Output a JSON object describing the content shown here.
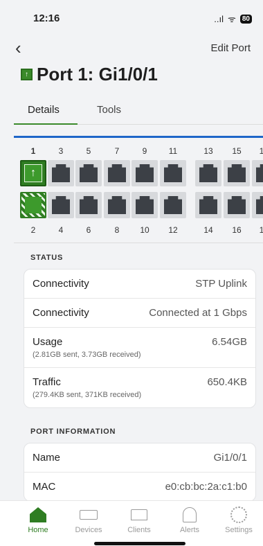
{
  "status_bar": {
    "time": "12:16",
    "signal": "..ıl",
    "wifi": "ᯤ",
    "battery": "80"
  },
  "navbar": {
    "back": "‹",
    "action": "Edit Port"
  },
  "title": {
    "icon_glyph": "↑",
    "text": "Port 1: Gi1/0/1"
  },
  "tabs": [
    {
      "label": "Details",
      "active": true
    },
    {
      "label": "Tools",
      "active": false
    }
  ],
  "ports": {
    "top_numbers": [
      "1",
      "3",
      "5",
      "7",
      "9",
      "11",
      "13",
      "15",
      "1"
    ],
    "bottom_numbers": [
      "2",
      "4",
      "6",
      "8",
      "10",
      "12",
      "14",
      "16",
      "1"
    ],
    "uplink_glyph": "↑"
  },
  "status": {
    "label": "STATUS",
    "rows": [
      {
        "label": "Connectivity",
        "value": "STP Uplink",
        "sub": ""
      },
      {
        "label": "Connectivity",
        "value": "Connected at 1 Gbps",
        "sub": ""
      },
      {
        "label": "Usage",
        "value": "6.54GB",
        "sub": "(2.81GB sent, 3.73GB received)"
      },
      {
        "label": "Traffic",
        "value": "650.4KB",
        "sub": "(279.4KB sent, 371KB received)"
      }
    ]
  },
  "port_info": {
    "label": "PORT INFORMATION",
    "rows": [
      {
        "label": "Name",
        "value": "Gi1/0/1"
      },
      {
        "label": "MAC",
        "value": "e0:cb:bc:2a:c1:b0"
      }
    ]
  },
  "bottom_nav": [
    {
      "label": "Home",
      "icon": "home-icon",
      "active": true
    },
    {
      "label": "Devices",
      "icon": "devices-icon",
      "active": false
    },
    {
      "label": "Clients",
      "icon": "laptop-icon",
      "active": false
    },
    {
      "label": "Alerts",
      "icon": "bell-icon",
      "active": false
    },
    {
      "label": "Settings",
      "icon": "gear-icon",
      "active": false
    }
  ],
  "colors": {
    "accent": "#2f7d22",
    "selected_blue": "#1e66c8"
  }
}
